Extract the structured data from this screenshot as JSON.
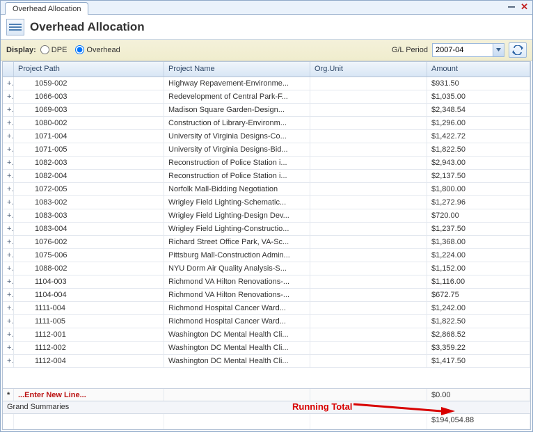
{
  "tab": {
    "title": "Overhead Allocation"
  },
  "header": {
    "title": "Overhead Allocation"
  },
  "toolbar": {
    "display_label": "Display:",
    "radio_dpe": "DPE",
    "radio_overhead": "Overhead",
    "gl_period_label": "G/L Period",
    "gl_period_value": "2007-04"
  },
  "columns": {
    "project_path": "Project Path",
    "project_name": "Project Name",
    "org_unit": "Org.Unit",
    "amount": "Amount"
  },
  "rows": [
    {
      "path": "1059-002",
      "name": "Highway Repavement-Environme...",
      "org": "",
      "amount": "$931.50"
    },
    {
      "path": "1066-003",
      "name": "Redevelopment of Central Park-F...",
      "org": "",
      "amount": "$1,035.00"
    },
    {
      "path": "1069-003",
      "name": "Madison Square Garden-Design...",
      "org": "",
      "amount": "$2,348.54"
    },
    {
      "path": "1080-002",
      "name": "Construction of Library-Environm...",
      "org": "",
      "amount": "$1,296.00"
    },
    {
      "path": "1071-004",
      "name": "University of Virginia Designs-Co...",
      "org": "",
      "amount": "$1,422.72"
    },
    {
      "path": "1071-005",
      "name": "University of Virginia Designs-Bid...",
      "org": "",
      "amount": "$1,822.50"
    },
    {
      "path": "1082-003",
      "name": "Reconstruction of Police Station i...",
      "org": "",
      "amount": "$2,943.00"
    },
    {
      "path": "1082-004",
      "name": "Reconstruction of Police Station i...",
      "org": "",
      "amount": "$2,137.50"
    },
    {
      "path": "1072-005",
      "name": "Norfolk Mall-Bidding Negotiation",
      "org": "",
      "amount": "$1,800.00"
    },
    {
      "path": "1083-002",
      "name": "Wrigley Field Lighting-Schematic...",
      "org": "",
      "amount": "$1,272.96"
    },
    {
      "path": "1083-003",
      "name": "Wrigley Field Lighting-Design Dev...",
      "org": "",
      "amount": "$720.00"
    },
    {
      "path": "1083-004",
      "name": "Wrigley Field Lighting-Constructio...",
      "org": "",
      "amount": "$1,237.50"
    },
    {
      "path": "1076-002",
      "name": "Richard Street Office Park, VA-Sc...",
      "org": "",
      "amount": "$1,368.00"
    },
    {
      "path": "1075-006",
      "name": "Pittsburg Mall-Construction Admin...",
      "org": "",
      "amount": "$1,224.00"
    },
    {
      "path": "1088-002",
      "name": "NYU Dorm Air Quality Analysis-S...",
      "org": "",
      "amount": "$1,152.00"
    },
    {
      "path": "1104-003",
      "name": "Richmond VA Hilton Renovations-...",
      "org": "",
      "amount": "$1,116.00"
    },
    {
      "path": "1104-004",
      "name": "Richmond VA Hilton Renovations-...",
      "org": "",
      "amount": "$672.75"
    },
    {
      "path": "1111-004",
      "name": "Richmond Hospital Cancer Ward...",
      "org": "",
      "amount": "$1,242.00"
    },
    {
      "path": "1111-005",
      "name": "Richmond Hospital Cancer Ward...",
      "org": "",
      "amount": "$1,822.50"
    },
    {
      "path": "1112-001",
      "name": "Washington DC Mental Health Cli...",
      "org": "",
      "amount": "$2,868.52"
    },
    {
      "path": "1112-002",
      "name": "Washington DC Mental Health Cli...",
      "org": "",
      "amount": "$3,359.22"
    },
    {
      "path": "1112-004",
      "name": "Washington DC Mental Health Cli...",
      "org": "",
      "amount": "$1,417.50"
    }
  ],
  "new_line": {
    "label": "...Enter New Line...",
    "amount": "$0.00"
  },
  "summary": {
    "label": "Grand Summaries",
    "total": "$194,054.88"
  },
  "annotation": {
    "running_total": "Running Total"
  }
}
